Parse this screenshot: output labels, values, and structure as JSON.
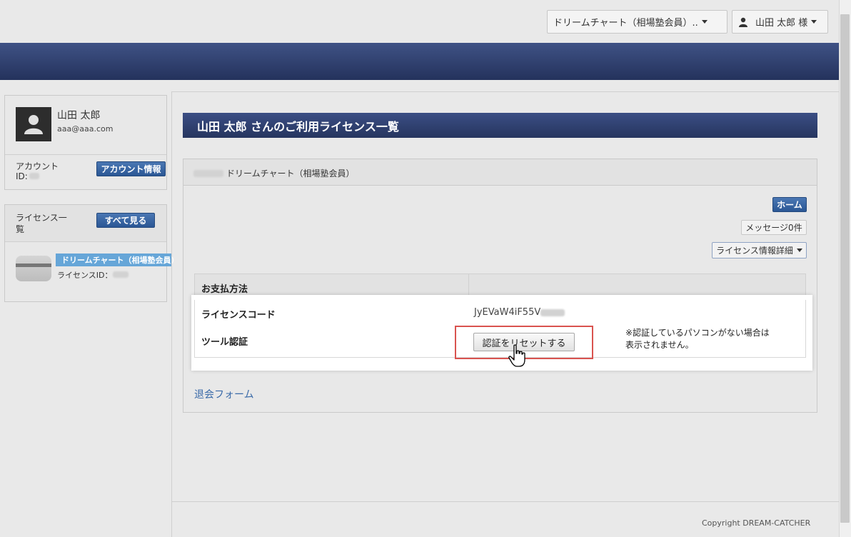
{
  "header": {
    "product_dropdown": "ドリームチャート（相場塾会員）..",
    "user_dropdown": "山田 太郎 様"
  },
  "profile": {
    "name": "山田 太郎",
    "email": "aaa@aaa.com",
    "account_id_label": "アカウント ID:",
    "account_info_button": "アカウント情報"
  },
  "license_sidebar": {
    "heading": "ライセンス一覧",
    "view_all_button": "すべて見る",
    "item_name": "ドリームチャート（相場塾会員）",
    "item_id_label": "ライセンスID："
  },
  "main": {
    "page_title": "山田 太郎 さんのご利用ライセンス一覧",
    "card_title": "ドリームチャート（相場塾会員）",
    "home_button": "ホーム",
    "messages_button": "メッセージ0件",
    "license_detail_button": "ライセンス情報詳細",
    "table": {
      "payment_label": "お支払方法",
      "license_code_label": "ライセンスコード",
      "license_code_value": "JyEVaW4iF55V",
      "tool_auth_label": "ツール認証",
      "reset_button": "認証をリセットする",
      "note_line1": "※認証しているパソコンがない場合は",
      "note_line2": "表示されません。"
    },
    "withdraw_link": "退会フォーム"
  },
  "footer": {
    "copyright": "Copyright DREAM-CATCHER"
  }
}
